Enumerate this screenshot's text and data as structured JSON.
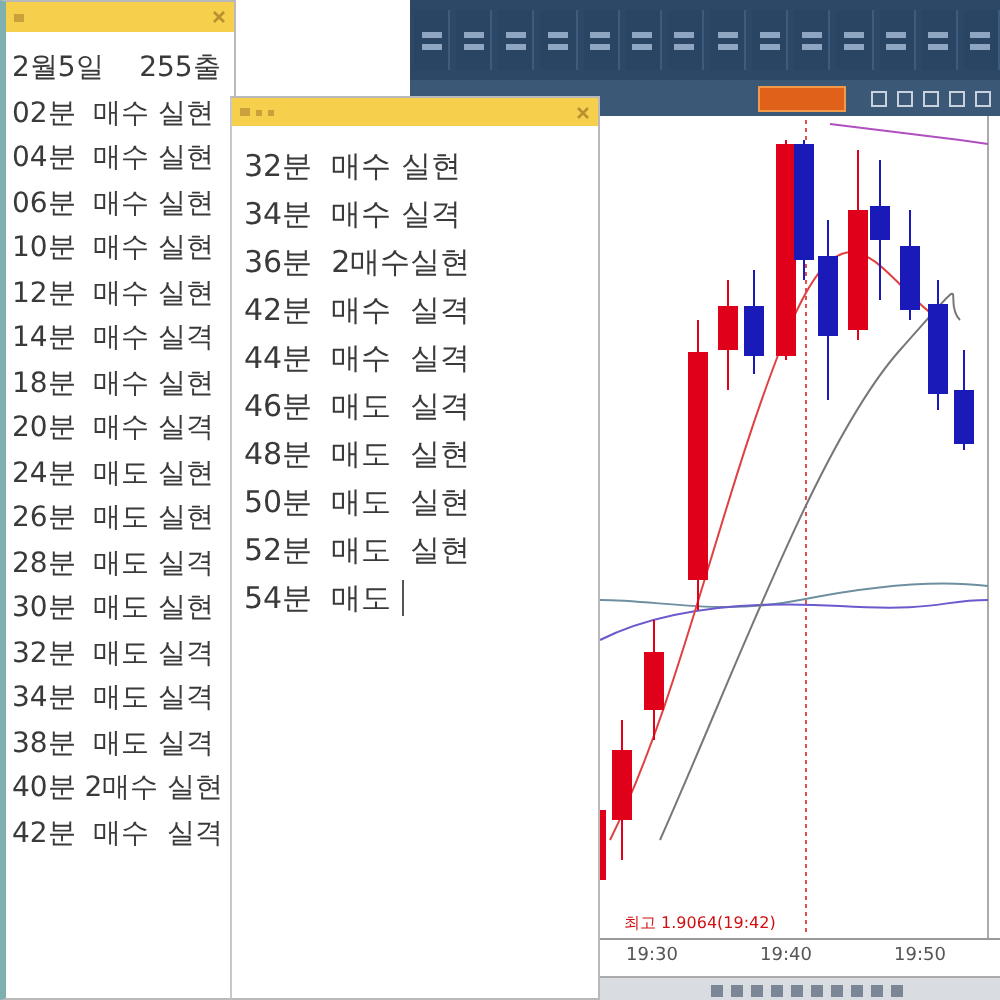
{
  "notepads": [
    {
      "lines": [
        "2월5일    255출",
        "02분  매수 실현",
        "04분  매수 실현",
        "06분  매수 실현",
        "10분  매수 실현",
        "12분  매수 실현",
        "14분  매수 실격",
        "18분  매수 실현",
        "20분  매수 실격",
        "24분  매도 실현",
        "26분  매도 실현",
        "28분  매도 실격",
        "30분  매도 실현",
        "32분  매도 실격",
        "34분  매도 실격",
        "38분  매도 실격",
        "40분 2매수 실현",
        "42분  매수  실격"
      ],
      "caret": false
    },
    {
      "lines": [
        "32분  매수 실현",
        "34분  매수 실격",
        "36분  2매수실현",
        "42분  매수  실격",
        "44분  매수  실격",
        "46분  매도  실격",
        "48분  매도  실현",
        "50분  매도  실현",
        "52분  매도  실현",
        "54분  매도 "
      ],
      "caret": true
    }
  ],
  "chart": {
    "high_label": "최고 1.9064(19:42)",
    "time_labels": [
      "19:30",
      "19:40",
      "19:50"
    ]
  }
}
